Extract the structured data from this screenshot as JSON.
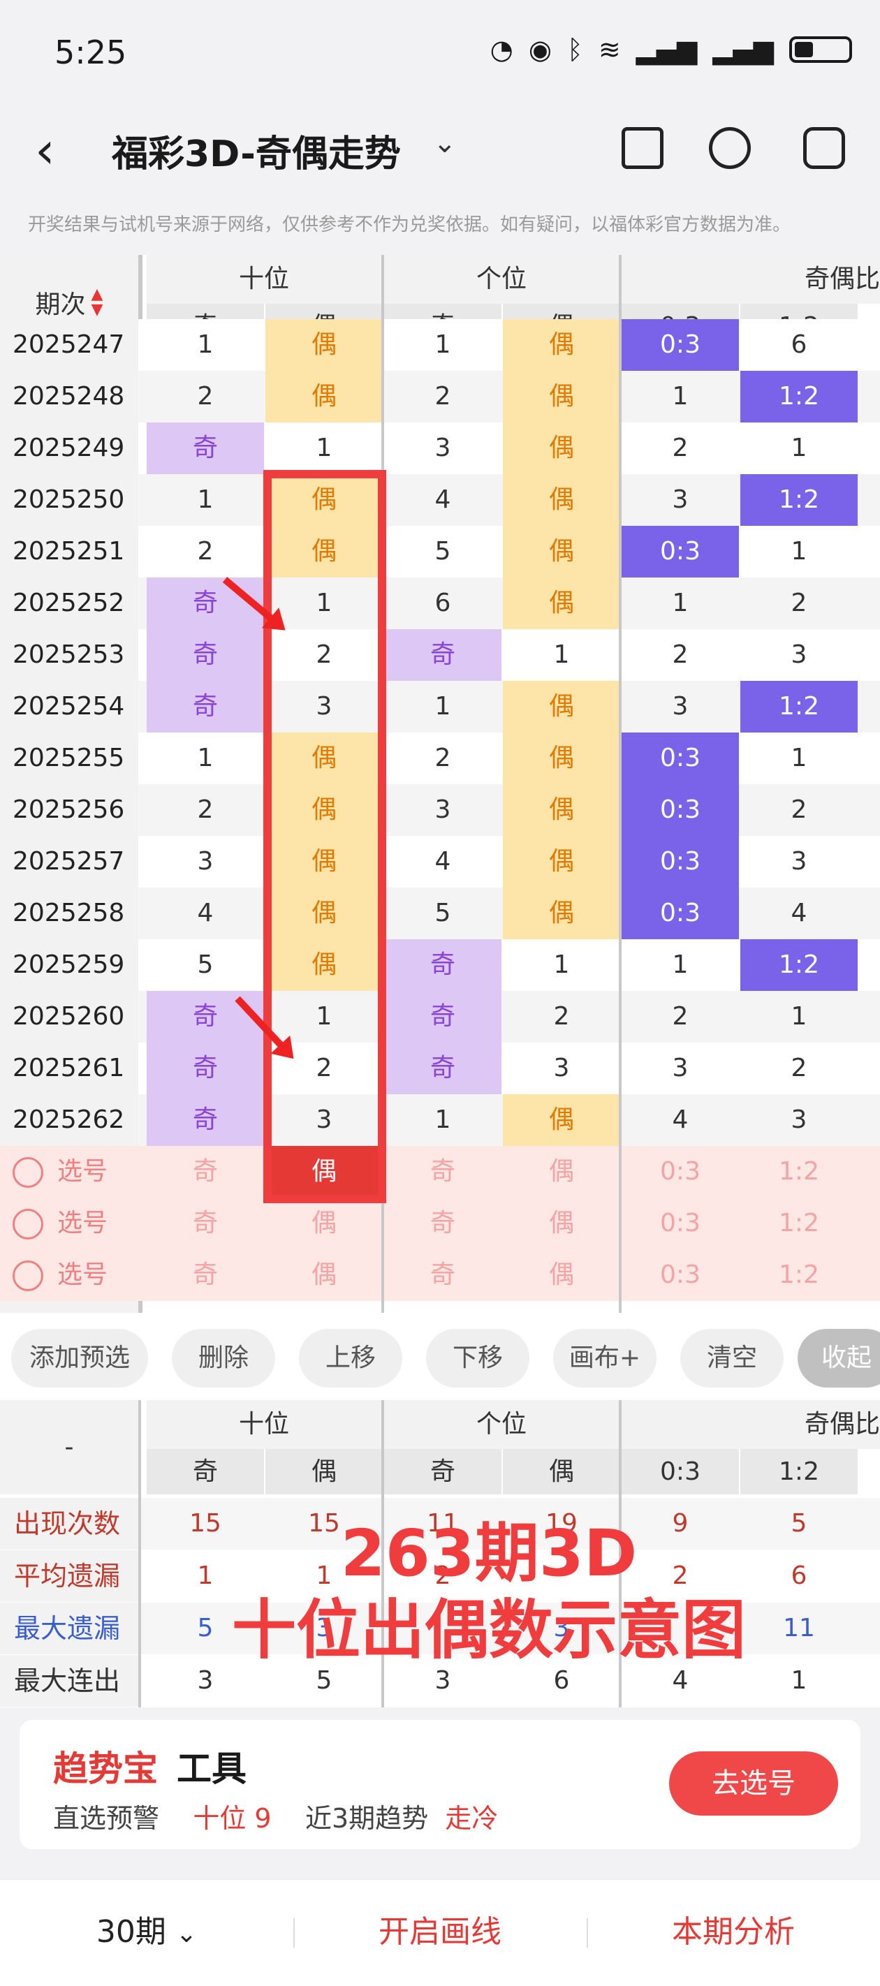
{
  "status": {
    "time": "5:25"
  },
  "header": {
    "title": "福彩3D-奇偶走势",
    "notice": "开奖结果与试机号来源于网络，仅供参考不作为兑奖依据。如有疑问，以福体彩官方数据为准。"
  },
  "table": {
    "issue_header": "期次",
    "groups": [
      "十位",
      "个位",
      "奇偶比"
    ],
    "sub": [
      "奇",
      "偶",
      "奇",
      "偶",
      "0:3",
      "1:2"
    ],
    "rows": [
      {
        "issue": "2025247",
        "c": [
          "1",
          "偶",
          "1",
          "偶",
          "0:3",
          "6"
        ],
        "s": [
          "",
          "even",
          "",
          "even",
          "hl",
          ""
        ]
      },
      {
        "issue": "2025248",
        "c": [
          "2",
          "偶",
          "2",
          "偶",
          "1",
          "1:2"
        ],
        "s": [
          "",
          "even",
          "",
          "even",
          "",
          "hl"
        ]
      },
      {
        "issue": "2025249",
        "c": [
          "奇",
          "1",
          "3",
          "偶",
          "2",
          "1"
        ],
        "s": [
          "odd",
          "",
          "",
          "even",
          "",
          ""
        ]
      },
      {
        "issue": "2025250",
        "c": [
          "1",
          "偶",
          "4",
          "偶",
          "3",
          "1:2"
        ],
        "s": [
          "",
          "even",
          "",
          "even",
          "",
          "hl"
        ]
      },
      {
        "issue": "2025251",
        "c": [
          "2",
          "偶",
          "5",
          "偶",
          "0:3",
          "1"
        ],
        "s": [
          "",
          "even",
          "",
          "even",
          "hl",
          ""
        ]
      },
      {
        "issue": "2025252",
        "c": [
          "奇",
          "1",
          "6",
          "偶",
          "1",
          "2"
        ],
        "s": [
          "odd",
          "",
          "",
          "even",
          "",
          ""
        ]
      },
      {
        "issue": "2025253",
        "c": [
          "奇",
          "2",
          "奇",
          "1",
          "2",
          "3"
        ],
        "s": [
          "odd",
          "",
          "odd",
          "",
          "",
          ""
        ]
      },
      {
        "issue": "2025254",
        "c": [
          "奇",
          "3",
          "1",
          "偶",
          "3",
          "1:2"
        ],
        "s": [
          "odd",
          "",
          "",
          "even",
          "",
          "hl"
        ]
      },
      {
        "issue": "2025255",
        "c": [
          "1",
          "偶",
          "2",
          "偶",
          "0:3",
          "1"
        ],
        "s": [
          "",
          "even",
          "",
          "even",
          "hl",
          ""
        ]
      },
      {
        "issue": "2025256",
        "c": [
          "2",
          "偶",
          "3",
          "偶",
          "0:3",
          "2"
        ],
        "s": [
          "",
          "even",
          "",
          "even",
          "hl",
          ""
        ]
      },
      {
        "issue": "2025257",
        "c": [
          "3",
          "偶",
          "4",
          "偶",
          "0:3",
          "3"
        ],
        "s": [
          "",
          "even",
          "",
          "even",
          "hl",
          ""
        ]
      },
      {
        "issue": "2025258",
        "c": [
          "4",
          "偶",
          "5",
          "偶",
          "0:3",
          "4"
        ],
        "s": [
          "",
          "even",
          "",
          "even",
          "hl",
          ""
        ]
      },
      {
        "issue": "2025259",
        "c": [
          "5",
          "偶",
          "奇",
          "1",
          "1",
          "1:2"
        ],
        "s": [
          "",
          "even",
          "odd",
          "",
          "",
          "hl"
        ]
      },
      {
        "issue": "2025260",
        "c": [
          "奇",
          "1",
          "奇",
          "2",
          "2",
          "1"
        ],
        "s": [
          "odd",
          "",
          "odd",
          "",
          "",
          ""
        ]
      },
      {
        "issue": "2025261",
        "c": [
          "奇",
          "2",
          "奇",
          "3",
          "3",
          "2"
        ],
        "s": [
          "odd",
          "",
          "odd",
          "",
          "",
          ""
        ]
      },
      {
        "issue": "2025262",
        "c": [
          "奇",
          "3",
          "1",
          "偶",
          "4",
          "3"
        ],
        "s": [
          "odd",
          "",
          "",
          "even",
          "",
          ""
        ]
      }
    ],
    "pick_label": "选号",
    "pick_cells": [
      "奇",
      "偶",
      "奇",
      "偶",
      "0:3",
      "1:2"
    ]
  },
  "toolbar": {
    "chips": [
      "添加预选",
      "删除",
      "上移",
      "下移",
      "画布+",
      "清空",
      "收起"
    ]
  },
  "stats": {
    "dash": "-",
    "rows": [
      {
        "label": "出现次数",
        "color": "#c0392b",
        "vals": [
          "15",
          "15",
          "11",
          "19",
          "9",
          "5"
        ]
      },
      {
        "label": "平均遗漏",
        "color": "#c0392b",
        "vals": [
          "1",
          "1",
          "2",
          "",
          "2",
          "6"
        ]
      },
      {
        "label": "最大遗漏",
        "color": "#3a5fcd",
        "vals": [
          "5",
          "3",
          "",
          "3",
          "",
          "11"
        ]
      },
      {
        "label": "最大连出",
        "color": "#333333",
        "vals": [
          "3",
          "5",
          "3",
          "6",
          "4",
          "1"
        ]
      }
    ],
    "overlay_line1": "263期3D",
    "overlay_line2": "十位出偶数示意图"
  },
  "promo": {
    "brand": "趋势宝",
    "tool": "工具",
    "label1": "直选预警",
    "val1": "十位 9",
    "label2": "近3期趋势",
    "val2": "走冷",
    "button": "去选号"
  },
  "bottom": {
    "periods": "30期",
    "draw": "开启画线",
    "analysis": "本期分析"
  },
  "colors": {
    "odd": "#dcc7f5",
    "even": "#fde4a8",
    "ratio": "#7a63e8",
    "accent": "#e53935"
  }
}
